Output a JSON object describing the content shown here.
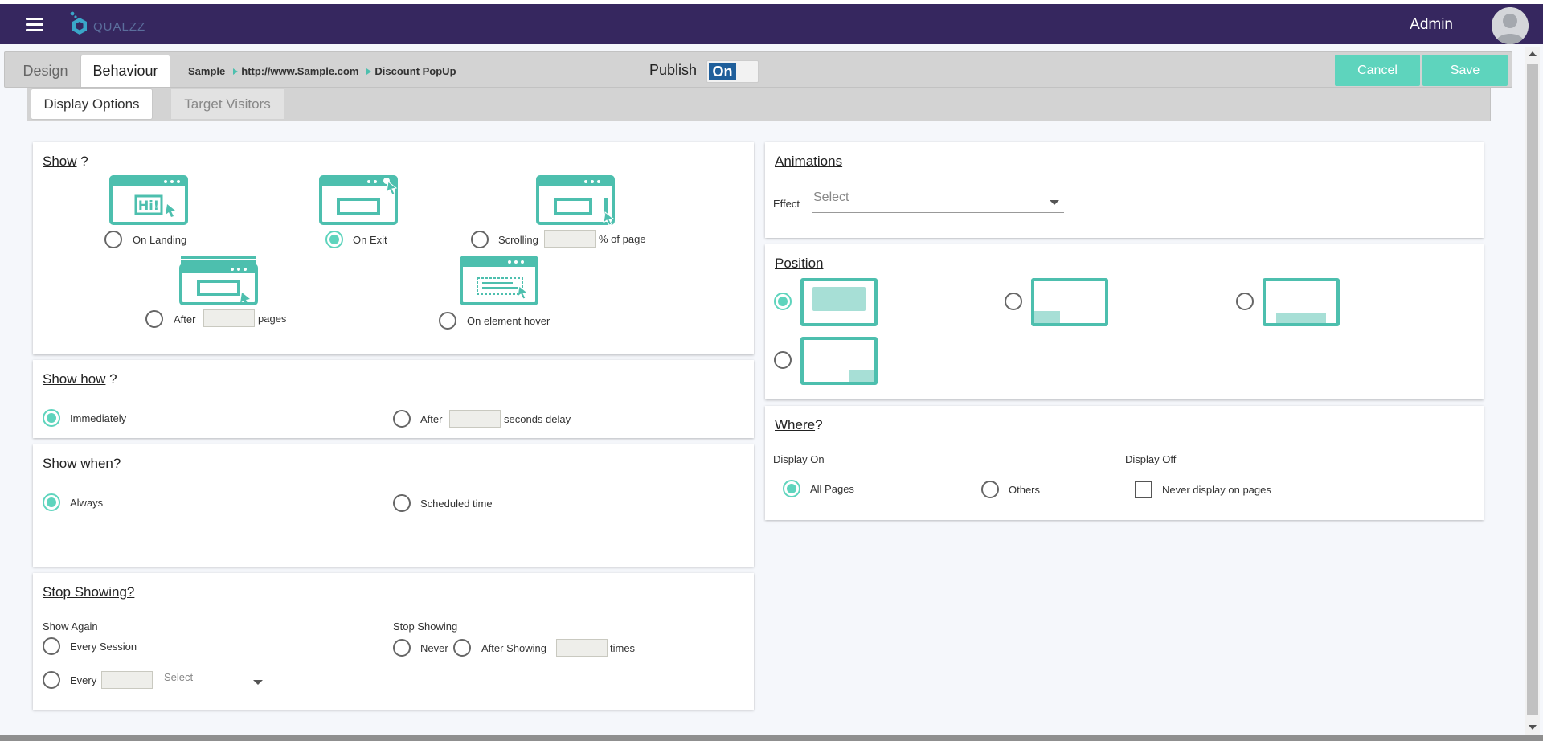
{
  "header": {
    "logo_text": "QUALZZ",
    "user_name": "Admin"
  },
  "toolbar": {
    "tabs": [
      "Design",
      "Behaviour"
    ],
    "breadcrumb": [
      "Sample",
      "http://www.Sample.com",
      "Discount PopUp"
    ],
    "publish_label": "Publish",
    "publish_state": "On",
    "cancel_label": "Cancel",
    "save_label": "Save"
  },
  "subtabs": [
    "Display Options",
    "Target Visitors"
  ],
  "show": {
    "title": "Show",
    "title_suffix": " ?",
    "options": {
      "on_landing": "On Landing",
      "on_exit": "On Exit",
      "scrolling": "Scrolling",
      "percent_suffix": "% of page",
      "after": "After",
      "pages_suffix": "pages",
      "element_hover": "On element hover"
    },
    "selected": "On Exit"
  },
  "show_how": {
    "title": "Show how",
    "title_suffix": " ?",
    "immediately": "Immediately",
    "after": "After",
    "seconds_suffix": "seconds delay",
    "selected": "Immediately"
  },
  "show_when": {
    "title": "Show when?",
    "always": "Always",
    "scheduled": "Scheduled time",
    "selected": "Always"
  },
  "stop_showing": {
    "title": "Stop Showing?",
    "show_again_label": "Show Again",
    "every_session": "Every Session",
    "every": "Every",
    "select_placeholder": "Select",
    "stop_label": "Stop Showing",
    "never": "Never",
    "after_showing": "After Showing",
    "times_suffix": "times"
  },
  "animations": {
    "title": "Animations",
    "effect_label": "Effect",
    "effect_placeholder": "Select"
  },
  "position": {
    "title": "Position",
    "selected": "center"
  },
  "where": {
    "title": "Where",
    "title_suffix": "?",
    "display_on_label": "Display On",
    "all_pages": "All Pages",
    "others": "Others",
    "display_off_label": "Display Off",
    "never_display": "Never display on pages",
    "selected": "All Pages"
  },
  "colors": {
    "header_bg": "#36275f",
    "accent": "#5ed4bd",
    "icon_teal": "#4dbfae",
    "toggle_on": "#1f5f9b"
  }
}
